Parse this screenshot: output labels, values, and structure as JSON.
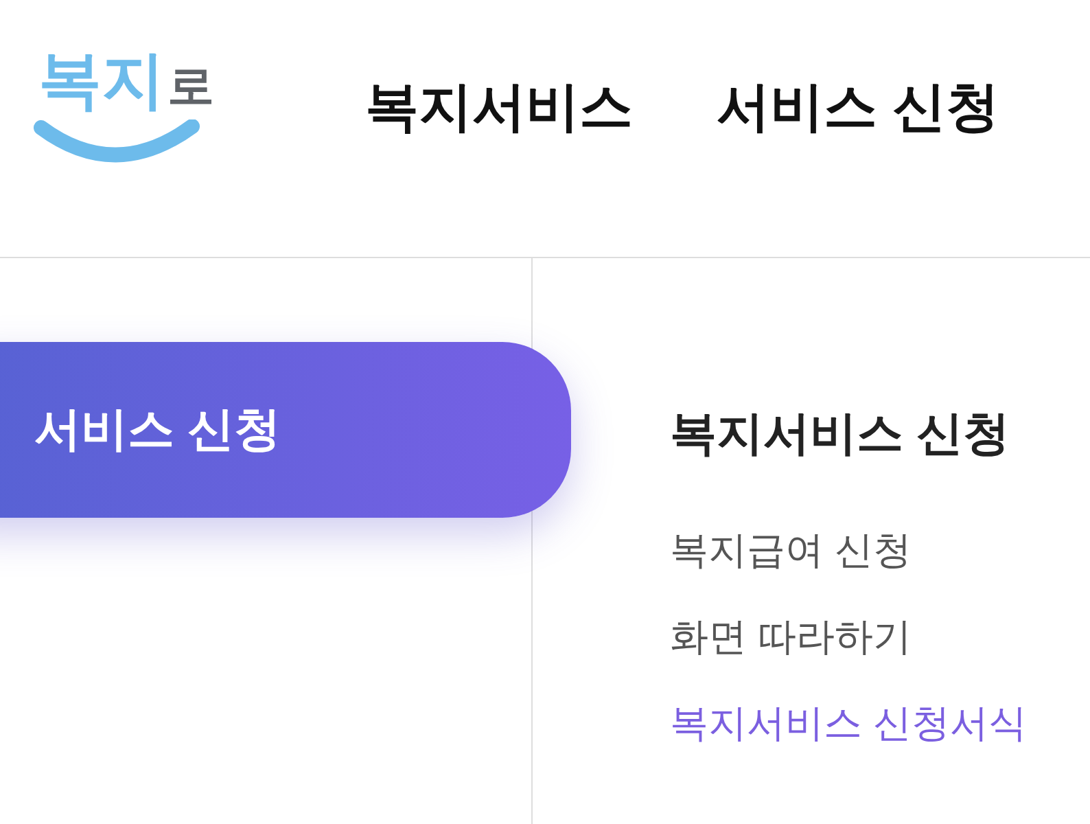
{
  "logo": {
    "parts": [
      "복지",
      "로"
    ]
  },
  "top_nav": [
    {
      "label": "복지서비스"
    },
    {
      "label": "서비스 신청"
    }
  ],
  "sidebar": {
    "items": [
      {
        "label": "서비스 신청",
        "selected": true
      }
    ]
  },
  "submenu": {
    "title": "복지서비스 신청",
    "items": [
      {
        "label": "복지급여 신청",
        "selected": false
      },
      {
        "label": "화면 따라하기",
        "selected": false
      },
      {
        "label": "복지서비스 신청서식",
        "selected": true
      }
    ]
  }
}
